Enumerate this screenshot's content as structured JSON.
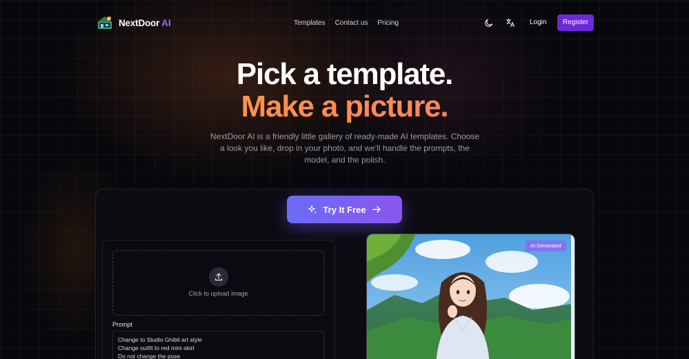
{
  "nav": {
    "brand_name": "NextDoor",
    "brand_ai": "AI",
    "links": [
      "Templates",
      "Contact us",
      "Pricing"
    ],
    "login": "Login",
    "register": "Register",
    "theme_icon": "moon-icon",
    "language_icon": "translate-icon"
  },
  "hero": {
    "title_line1": "Pick a template.",
    "title_line2": "Make a picture.",
    "description": "NextDoor AI is a friendly little gallery of ready-made AI templates. Choose a look you like, drop in your photo, and we'll handle the prompts, the model, and the polish."
  },
  "cta": {
    "label": "Try It Free",
    "icon": "sparkles-icon",
    "arrow": "arrow-right-icon"
  },
  "demo": {
    "upload_label": "Click to upload image",
    "upload_icon": "upload-icon",
    "prompt_label": "Prompt",
    "prompt_lines": [
      "Change to Studio Ghibli art style",
      "Change outfit to red mini skirt",
      "Do not change the pose"
    ],
    "badge": "AI Generated"
  },
  "colors": {
    "accent": "#6d28d9",
    "gradient_orange": "#ffa23a",
    "gradient_coral": "#ff7a6a",
    "cta_start": "#6b6cf6",
    "cta_end": "#8a55f1"
  }
}
